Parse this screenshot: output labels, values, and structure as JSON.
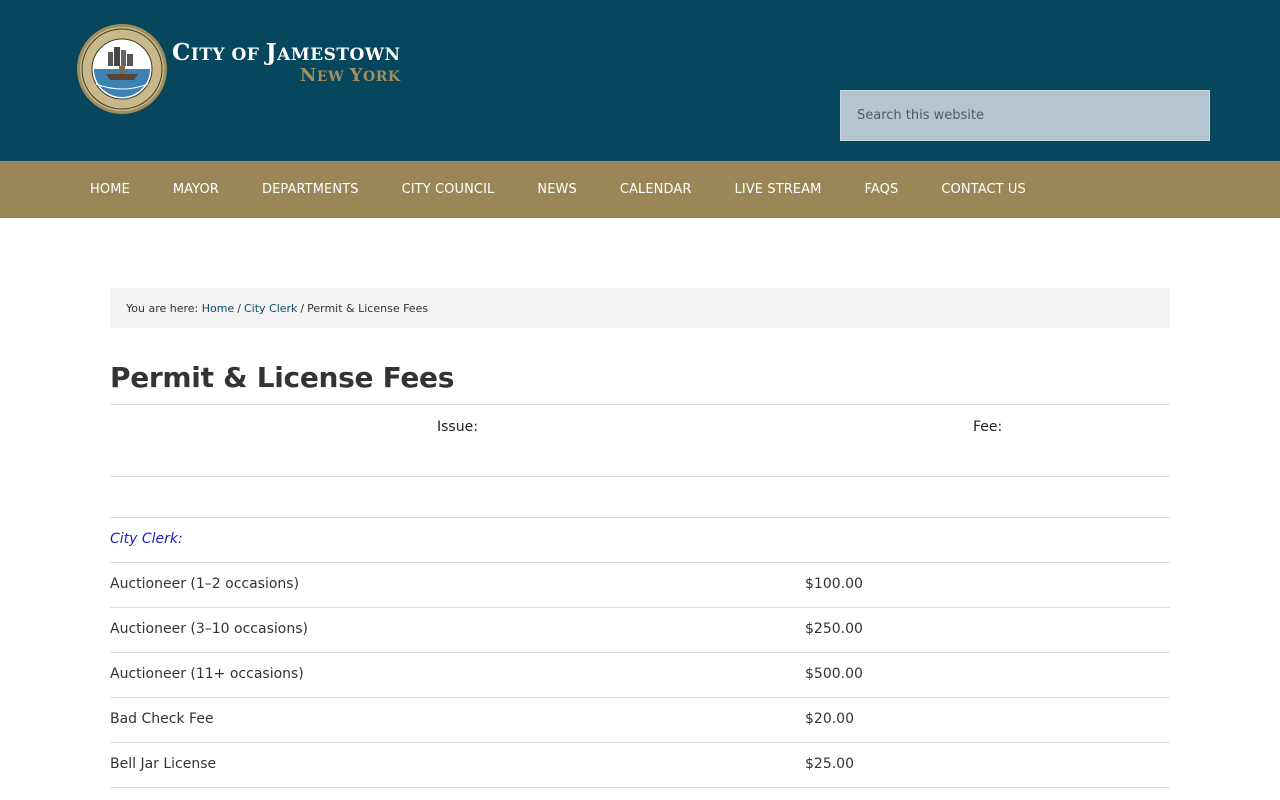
{
  "header": {
    "title": "CITY OF JAMESTOWN",
    "title_parts": {
      "c": "C",
      "ity": "ITY OF ",
      "j": "J",
      "amestown": "AMESTOWN"
    },
    "subtitle_parts": {
      "n": "N",
      "ew": "EW ",
      "y": "Y",
      "ork": "ORK"
    },
    "seal_text": "CITY OF JAMESTOWN N.Y. · INCORPORATED 1886",
    "search_placeholder": "Search this website"
  },
  "nav": {
    "items": [
      "HOME",
      "MAYOR",
      "DEPARTMENTS",
      "CITY COUNCIL",
      "NEWS",
      "CALENDAR",
      "LIVE STREAM",
      "FAQS",
      "CONTACT US"
    ]
  },
  "breadcrumb": {
    "prefix": "You are here:",
    "items": [
      "Home",
      "City Clerk"
    ],
    "current": "Permit & License Fees",
    "separator": "/"
  },
  "page": {
    "title": "Permit & License Fees"
  },
  "table": {
    "headers": {
      "issue": "Issue:",
      "fee": "Fee:"
    },
    "section": "City Clerk:",
    "rows": [
      {
        "name": "Auctioneer (1–2 occasions)",
        "fee": "$100.00"
      },
      {
        "name": "Auctioneer (3–10 occasions)",
        "fee": "$250.00"
      },
      {
        "name": "Auctioneer (11+ occasions)",
        "fee": "$500.00"
      },
      {
        "name": "Bad Check Fee",
        "fee": "$20.00"
      },
      {
        "name": "Bell Jar License",
        "fee": "$25.00"
      }
    ]
  },
  "colors": {
    "header_bg": "#06475e",
    "nav_bg": "#9b8658",
    "accent_gold": "#a28e5c",
    "link": "#0c4c6b",
    "section_link": "#1d1dcc"
  }
}
